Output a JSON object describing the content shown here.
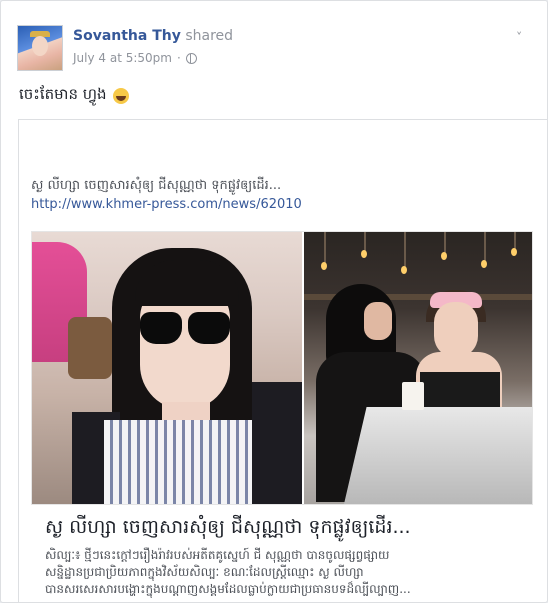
{
  "post": {
    "author": "Sovantha Thy",
    "action": "shared",
    "timestamp": "July 4 at 5:50pm",
    "separator": "·",
    "privacy_icon": "globe-icon",
    "menu_icon": "chevron-down-icon",
    "status_text": "ចេះតែមាន ហ្វូង",
    "status_emoji": "laughing-emoji-icon"
  },
  "shared_post": {
    "title": "ស្ង លីហ្សា ចេញសារសុំឲ្យ ជីសុណ្ណថា ទុកផ្លូវឲ្យដើរ...",
    "link": "http://www.khmer-press.com/news/62010"
  },
  "link_preview": {
    "title": "ស្ង លីហ្សា ចេញសារសុំឲ្យ ជីសុណ្ណថា ទុកផ្លូវឲ្យដើរ...",
    "description_lines": [
      "សិល្បៈ៖ ថ្មីៗនេះក្តៅៗរឿងរ៉ាវរបស់អតីតគូស្នេហ៍ ជី សុណ្ណថា បានចូលផ្សព្វផ្សាយ",
      "សន្និដ្ឋានប្រជាប្រិយភាពក្នុងវិស័យសិល្បៈ ខណៈដែលស្ត្រីឈ្មោះ ស្ង លីហ្សា",
      "បានសរសេរសារបង្ហោះក្នុងបណ្តាញសង្គមដែលធ្លាប់ក្លាយជាប្រធានបទដ៏ល្បីល្បាញ..."
    ]
  }
}
